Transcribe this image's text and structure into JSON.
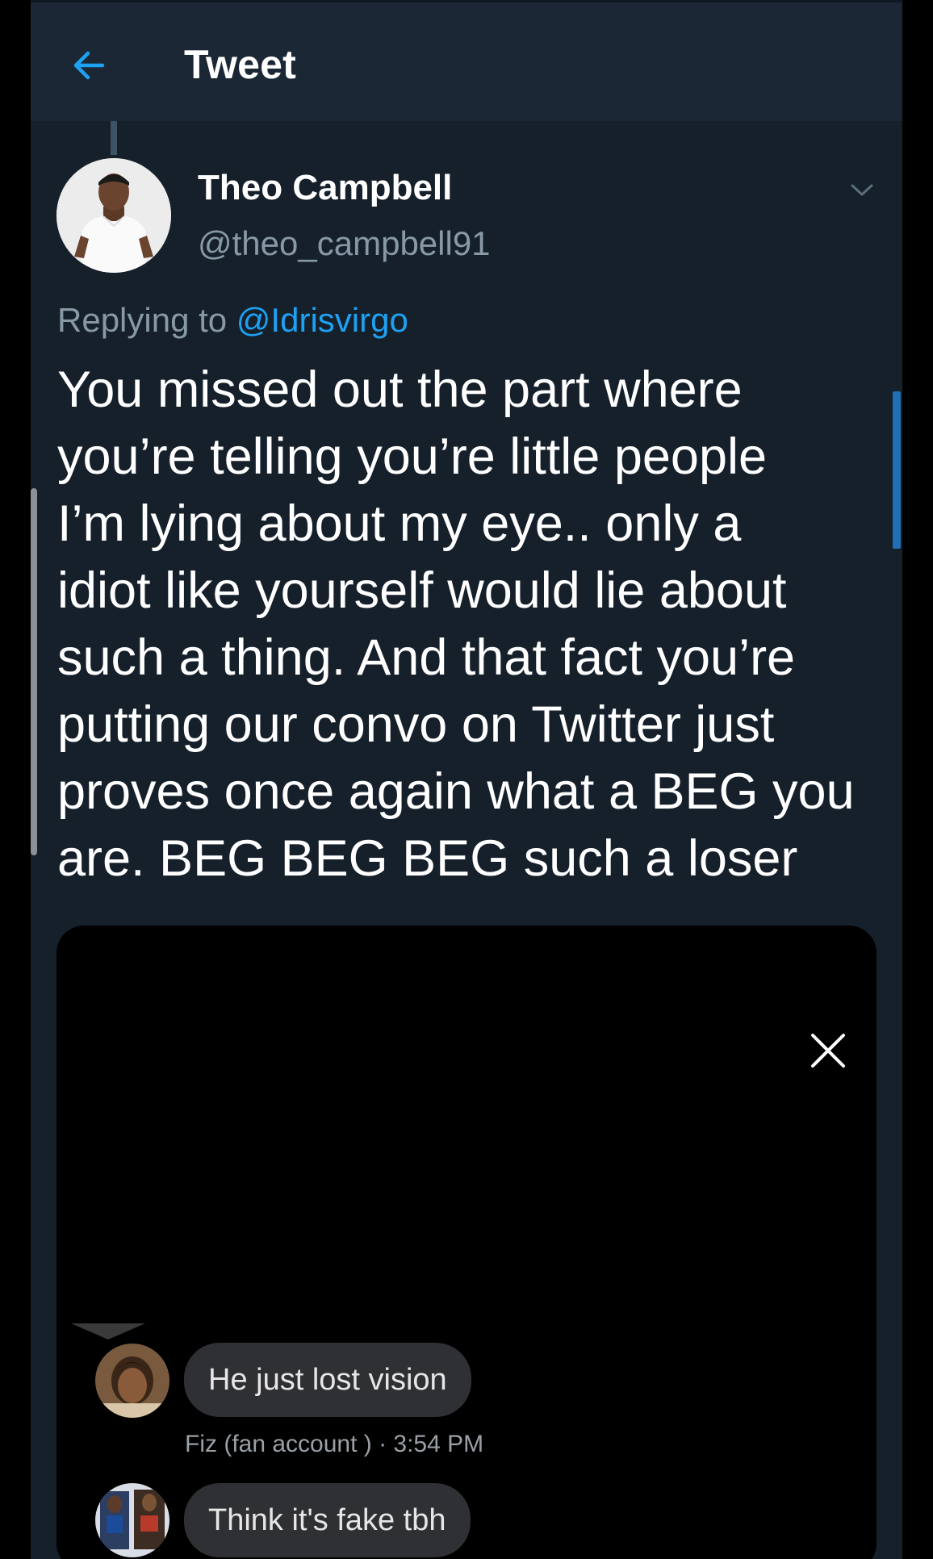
{
  "colors": {
    "background": "#15202b",
    "topbar": "#1b2735",
    "accent": "#1da1f2",
    "secondary_text": "#8899a6",
    "primary_text": "#ffffff"
  },
  "topbar": {
    "back_icon": "arrow-left-icon",
    "title": "Tweet"
  },
  "tweet": {
    "author": {
      "name": "Theo Campbell",
      "handle": "@theo_campbell91",
      "avatar_icon": "profile-photo"
    },
    "menu_icon": "chevron-down-icon",
    "replying_prefix": "Replying to",
    "replying_handle": "@Idrisvirgo",
    "text": "You missed out the part where\nyou’re telling you’re little people\nI’m lying about my eye.. only a\nidiot like yourself would lie about\nsuch a thing. And that fact you’re\nputting our convo on Twitter just\nproves once again what a BEG you\nare. BEG BEG BEG such a loser"
  },
  "media": {
    "close_icon": "close-icon",
    "messages": [
      {
        "text": "He just lost vision",
        "meta": "Fiz (fan account ) · 3:54 PM",
        "avatar_icon": "user-avatar"
      },
      {
        "text": "Think it's fake tbh",
        "avatar_icon": "user-avatar"
      }
    ]
  }
}
